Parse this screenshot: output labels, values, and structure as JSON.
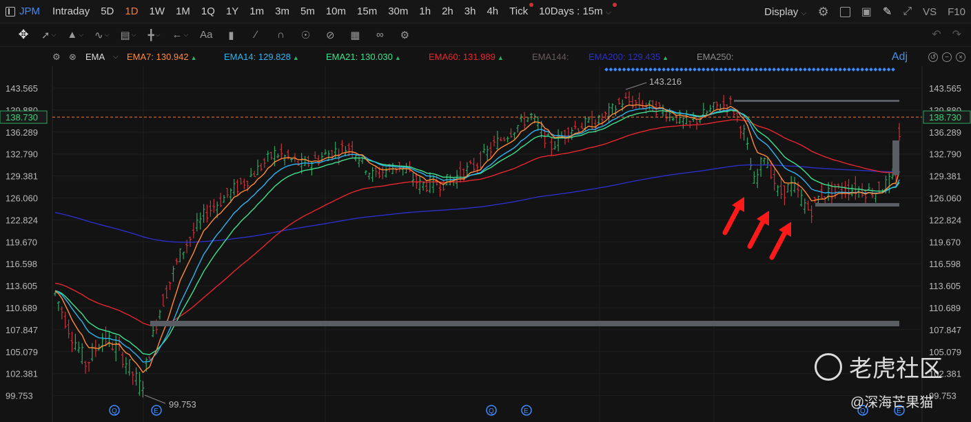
{
  "topbar": {
    "symbol": "JPM",
    "periods": [
      "Intraday",
      "5D",
      "1D",
      "1W",
      "1M",
      "1Q",
      "1Y",
      "1m",
      "3m",
      "5m",
      "10m",
      "15m",
      "30m",
      "1h",
      "2h",
      "3h",
      "4h",
      "Tick"
    ],
    "active_period": "1D",
    "range_label": "10Days : 15m",
    "display_label": "Display",
    "vs_label": "VS",
    "f10_label": "F10"
  },
  "toolbar": {
    "text_tool": "Aa"
  },
  "legend": {
    "indicator": "EMA",
    "adj_label": "Adj",
    "items": [
      {
        "label": "EMA7:",
        "value": "130.942",
        "color": "#ff8c3a"
      },
      {
        "label": "EMA14:",
        "value": "129.828",
        "color": "#31b4f0"
      },
      {
        "label": "EMA21:",
        "value": "130.030",
        "color": "#3fe38f"
      },
      {
        "label": "EMA60:",
        "value": "131.989",
        "color": "#e8262e"
      },
      {
        "label": "EMA144:",
        "value": "",
        "color": "#6b5a5c"
      },
      {
        "label": "EMA200:",
        "value": "129.435",
        "color": "#2a30c8"
      },
      {
        "label": "EMA250:",
        "value": "",
        "color": "#8a8a8a"
      }
    ]
  },
  "chart_data": {
    "type": "line",
    "y_ticks": [
      "143.565",
      "139.880",
      "136.289",
      "132.790",
      "129.381",
      "126.060",
      "122.824",
      "119.670",
      "116.598",
      "113.605",
      "110.689",
      "107.847",
      "105.079",
      "102.381",
      "99.753"
    ],
    "current_price": "138.730",
    "annotations": {
      "high": "143.216",
      "low": "99.753"
    },
    "event_markers": [
      "Q",
      "E",
      "Q",
      "E",
      "Q",
      "E"
    ],
    "colors": {
      "up": "#2fa764",
      "down": "#c9323a",
      "price_line": "#ff7a2f"
    }
  },
  "watermark": {
    "brand": "老虎社区",
    "author": "@深海芒果猫"
  }
}
